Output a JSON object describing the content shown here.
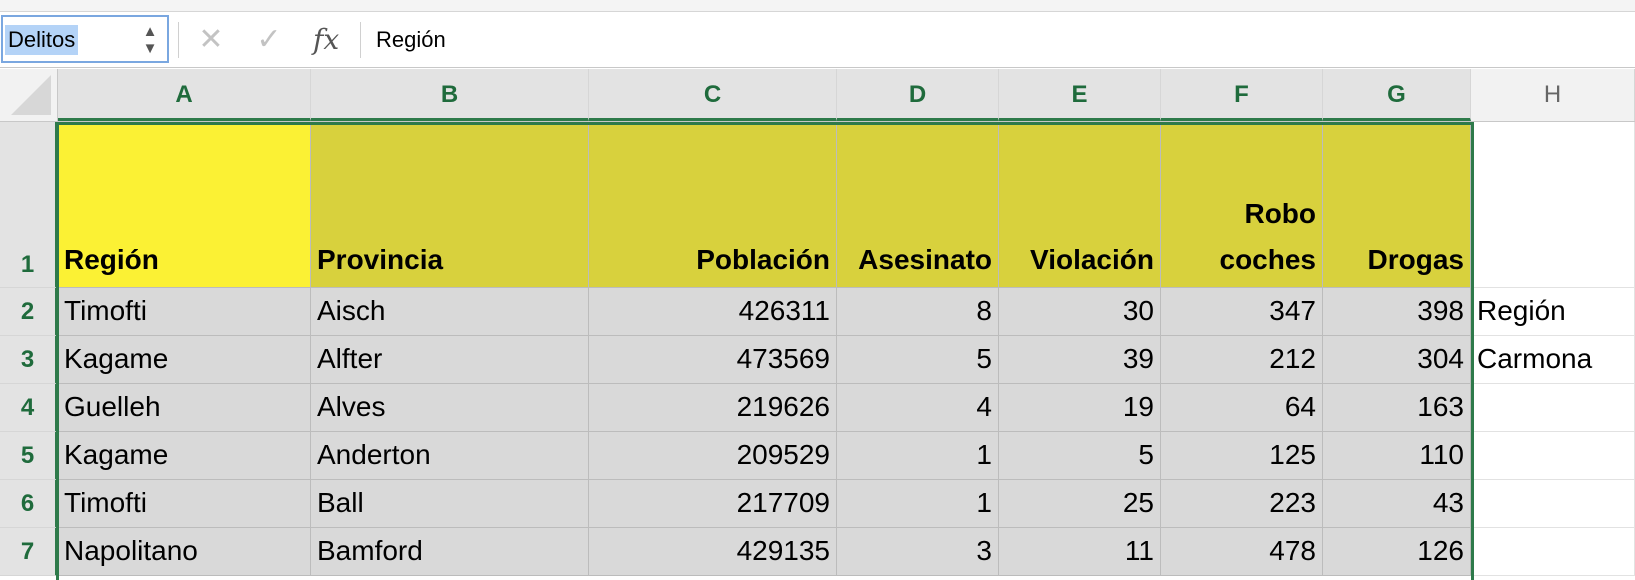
{
  "formula_bar": {
    "name_box": "Delitos",
    "name_box_stepper_up": "▲",
    "name_box_stepper_down": "▼",
    "cancel_glyph": "✕",
    "enter_glyph": "✓",
    "fx_label": "fx",
    "content": "Región"
  },
  "columns": [
    {
      "letter": "A",
      "selected": true
    },
    {
      "letter": "B",
      "selected": true
    },
    {
      "letter": "C",
      "selected": true
    },
    {
      "letter": "D",
      "selected": true
    },
    {
      "letter": "E",
      "selected": true
    },
    {
      "letter": "F",
      "selected": true
    },
    {
      "letter": "G",
      "selected": true
    },
    {
      "letter": "H",
      "selected": false
    }
  ],
  "row_numbers": [
    "1",
    "2",
    "3",
    "4",
    "5",
    "6",
    "7"
  ],
  "header_row": {
    "region": "Región",
    "provincia": "Provincia",
    "poblacion": "Población",
    "asesinato": "Asesinato",
    "violacion": "Violación",
    "robo_line1": "Robo",
    "robo_line2": "coches",
    "drogas": "Drogas"
  },
  "rows": [
    {
      "region": "Timofti",
      "provincia": "Aisch",
      "poblacion": "426311",
      "asesinato": "8",
      "violacion": "30",
      "robo": "347",
      "drogas": "398",
      "h": "Región"
    },
    {
      "region": "Kagame",
      "provincia": "Alfter",
      "poblacion": "473569",
      "asesinato": "5",
      "violacion": "39",
      "robo": "212",
      "drogas": "304",
      "h": "Carmona"
    },
    {
      "region": "Guelleh",
      "provincia": "Alves",
      "poblacion": "219626",
      "asesinato": "4",
      "violacion": "19",
      "robo": "64",
      "drogas": "163",
      "h": ""
    },
    {
      "region": "Kagame",
      "provincia": "Anderton",
      "poblacion": "209529",
      "asesinato": "1",
      "violacion": "5",
      "robo": "125",
      "drogas": "110",
      "h": ""
    },
    {
      "region": "Timofti",
      "provincia": "Ball",
      "poblacion": "217709",
      "asesinato": "1",
      "violacion": "25",
      "robo": "223",
      "drogas": "43",
      "h": ""
    },
    {
      "region": "Napolitano",
      "provincia": "Bamford",
      "poblacion": "429135",
      "asesinato": "3",
      "violacion": "11",
      "robo": "478",
      "drogas": "126",
      "h": ""
    }
  ],
  "colors": {
    "region_header_fill": "#fbf134",
    "header_fill": "#d8d13d",
    "data_fill": "#d9d9d9",
    "selection_accent": "#2e7a4a"
  }
}
